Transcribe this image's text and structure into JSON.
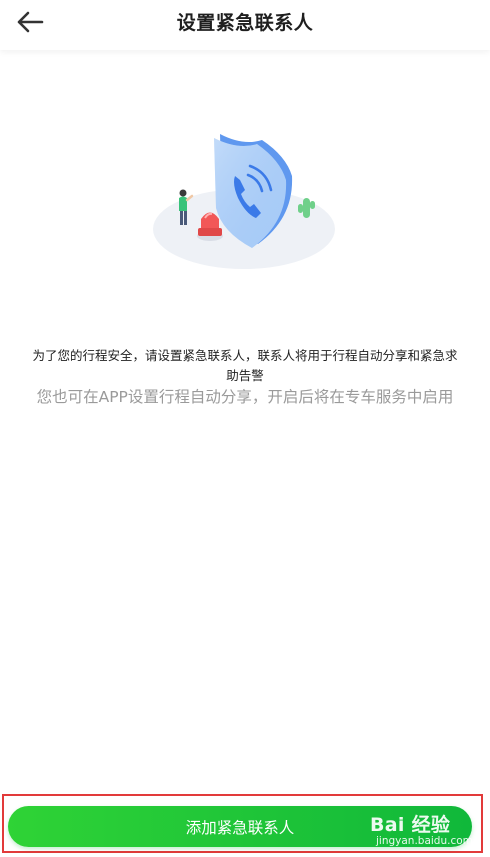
{
  "header": {
    "title": "设置紧急联系人",
    "back_icon": "arrow-left-icon"
  },
  "illustration": {
    "icon": "shield-phone-icon"
  },
  "main": {
    "description": "为了您的行程安全，请设置紧急联系人，联系人将用于行程自动分享和紧急求助告警",
    "hint": "您也可在APP设置行程自动分享，开启后将在专车服务中启用"
  },
  "footer": {
    "add_button_label": "添加紧急联系人"
  },
  "watermark": {
    "logo": "Bai 经验",
    "site": "jingyan.baidu.com"
  },
  "colors": {
    "accent": "#1ec63a",
    "highlight_border": "#e23a3a",
    "hint_text": "#9a9a9a"
  }
}
